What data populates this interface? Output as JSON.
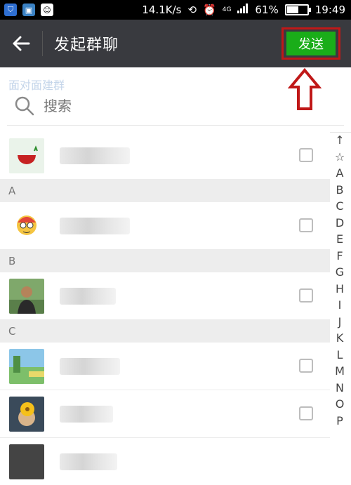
{
  "status_bar": {
    "speed": "14.1K/s",
    "signal_label": "4G",
    "battery": "61%",
    "battery_level": 0.61,
    "time": "19:49"
  },
  "toolbar": {
    "title": "发起群聊",
    "send_label": "发送"
  },
  "search": {
    "ghost_text": "面对面建群",
    "placeholder": "搜索"
  },
  "sections": [
    {
      "letter": "A"
    },
    {
      "letter": "B"
    },
    {
      "letter": "C"
    }
  ],
  "index_letters": [
    "↑",
    "☆",
    "A",
    "B",
    "C",
    "D",
    "E",
    "F",
    "G",
    "H",
    "I",
    "J",
    "K",
    "L",
    "M",
    "N",
    "O",
    "P"
  ],
  "colors": {
    "toolbar_bg": "#393a3f",
    "send_button": "#1aad19",
    "highlight": "#c01818"
  }
}
